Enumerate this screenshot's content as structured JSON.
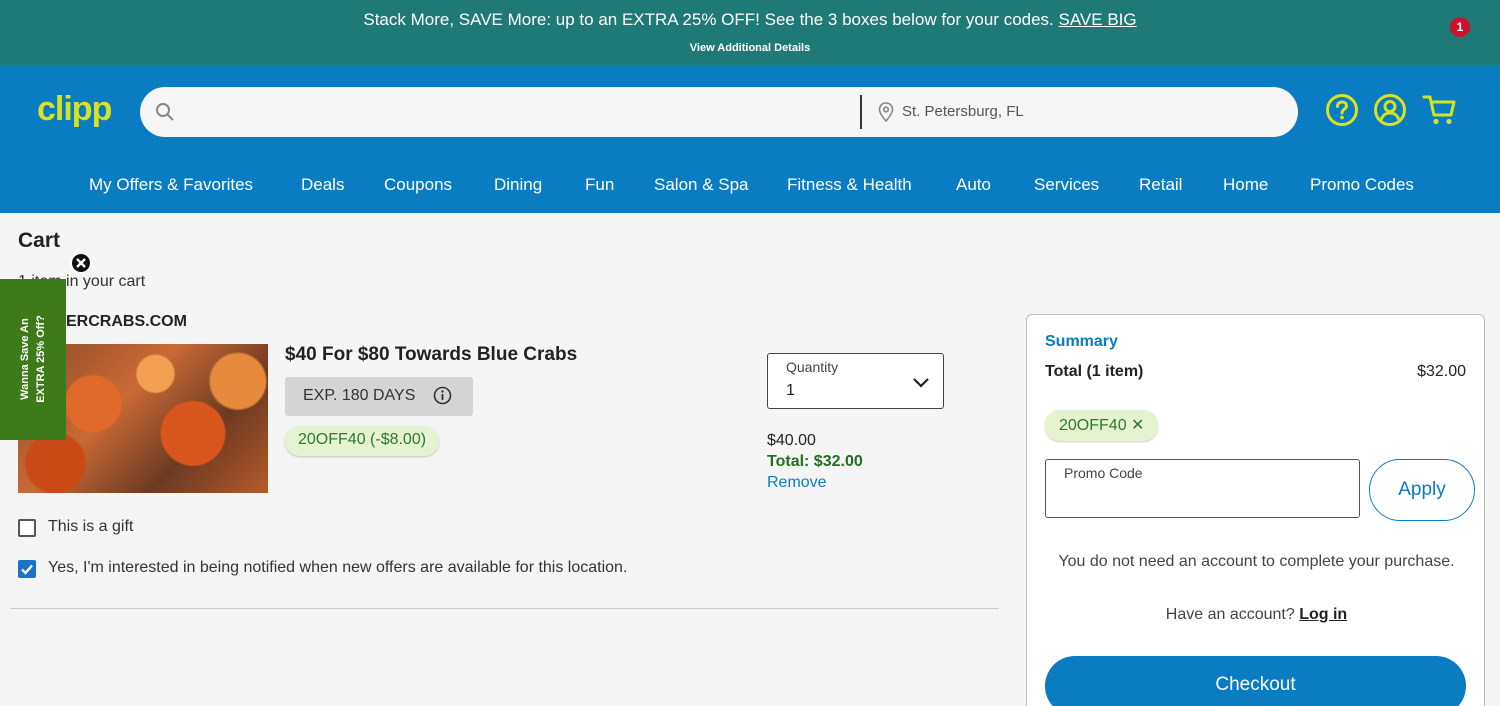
{
  "banner": {
    "message": "Stack More, SAVE More: up to an EXTRA 25% OFF! See the 3 boxes below for your codes.",
    "link": "SAVE BIG",
    "details": "View Additional Details"
  },
  "header": {
    "logo": "clipp",
    "search_placeholder": "",
    "location": "St. Petersburg, FL",
    "cart_count": "1",
    "colors": {
      "brand_blue": "#0a7cc1",
      "logo_yellow": "#d8e224",
      "banner_teal": "#1f7a76"
    }
  },
  "nav": {
    "items": [
      "My Offers & Favorites",
      "Deals",
      "Coupons",
      "Dining",
      "Fun",
      "Salon & Spa",
      "Fitness & Health",
      "Auto",
      "Services",
      "Retail",
      "Home",
      "Promo Codes"
    ]
  },
  "cart": {
    "title": "Cart",
    "count_text": "1 item in your cart",
    "merchant": "ERCRABS.COM",
    "item": {
      "title": "$40 For $80 Towards Blue Crabs",
      "expiry": "EXP. 180 DAYS",
      "promo": "20OFF40 (-$8.00)",
      "quantity_label": "Quantity",
      "quantity_value": "1",
      "price": "$40.00",
      "total": "Total: $32.00",
      "remove": "Remove"
    },
    "gift_label": "This is a gift",
    "gift_checked": false,
    "notify_label": "Yes, I'm interested in being notified when new offers are available for this location.",
    "notify_checked": true
  },
  "side_tab": {
    "line1": "Wanna Save An",
    "line2": "EXTRA 25% Off?"
  },
  "summary": {
    "title": "Summary",
    "total_label": "Total (1 item)",
    "total_value": "$32.00",
    "applied_code": "20OFF40 ✕",
    "promo_placeholder": "Promo Code",
    "apply": "Apply",
    "account_msg": "You do not need an account to complete your purchase.",
    "have_account": "Have an account?",
    "login": "Log in",
    "checkout": "Checkout"
  }
}
